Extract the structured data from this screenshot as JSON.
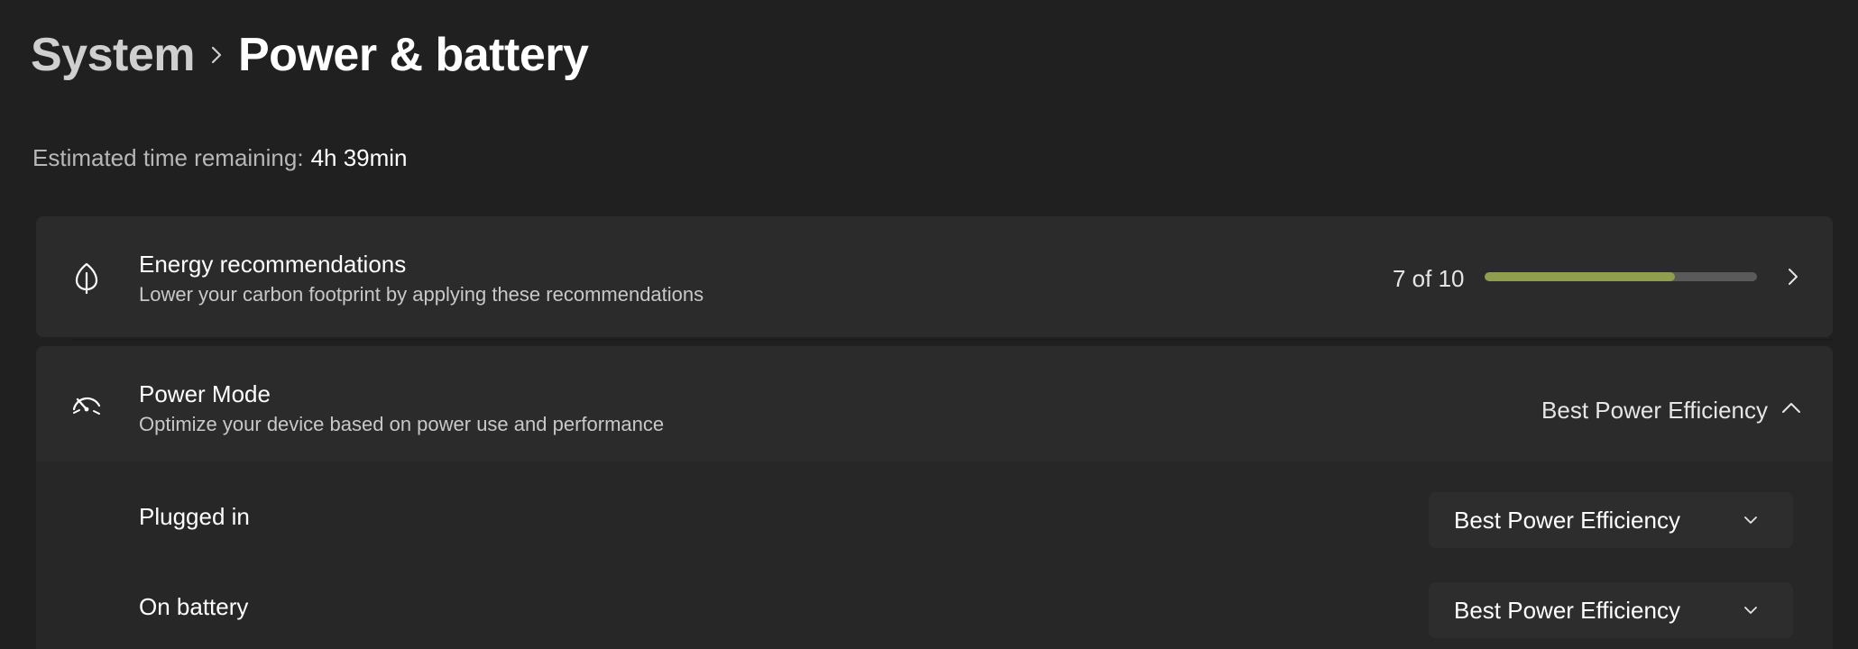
{
  "breadcrumb": {
    "parent": "System",
    "current": "Power & battery"
  },
  "battery": {
    "time_label": "Estimated time remaining:",
    "time_value": "4h 39min"
  },
  "energy": {
    "title": "Energy recommendations",
    "description": "Lower your carbon footprint by applying these recommendations",
    "count": "7 of 10",
    "progress_fraction": 0.7,
    "icon": "leaf-icon",
    "accent": "#8e9e4e"
  },
  "power_mode": {
    "title": "Power Mode",
    "description": "Optimize your device based on power use and performance",
    "value": "Best Power Efficiency",
    "icon": "speedometer-icon",
    "plugged_in": {
      "label": "Plugged in",
      "value": "Best Power Efficiency"
    },
    "on_battery": {
      "label": "On battery",
      "value": "Best Power Efficiency"
    }
  }
}
